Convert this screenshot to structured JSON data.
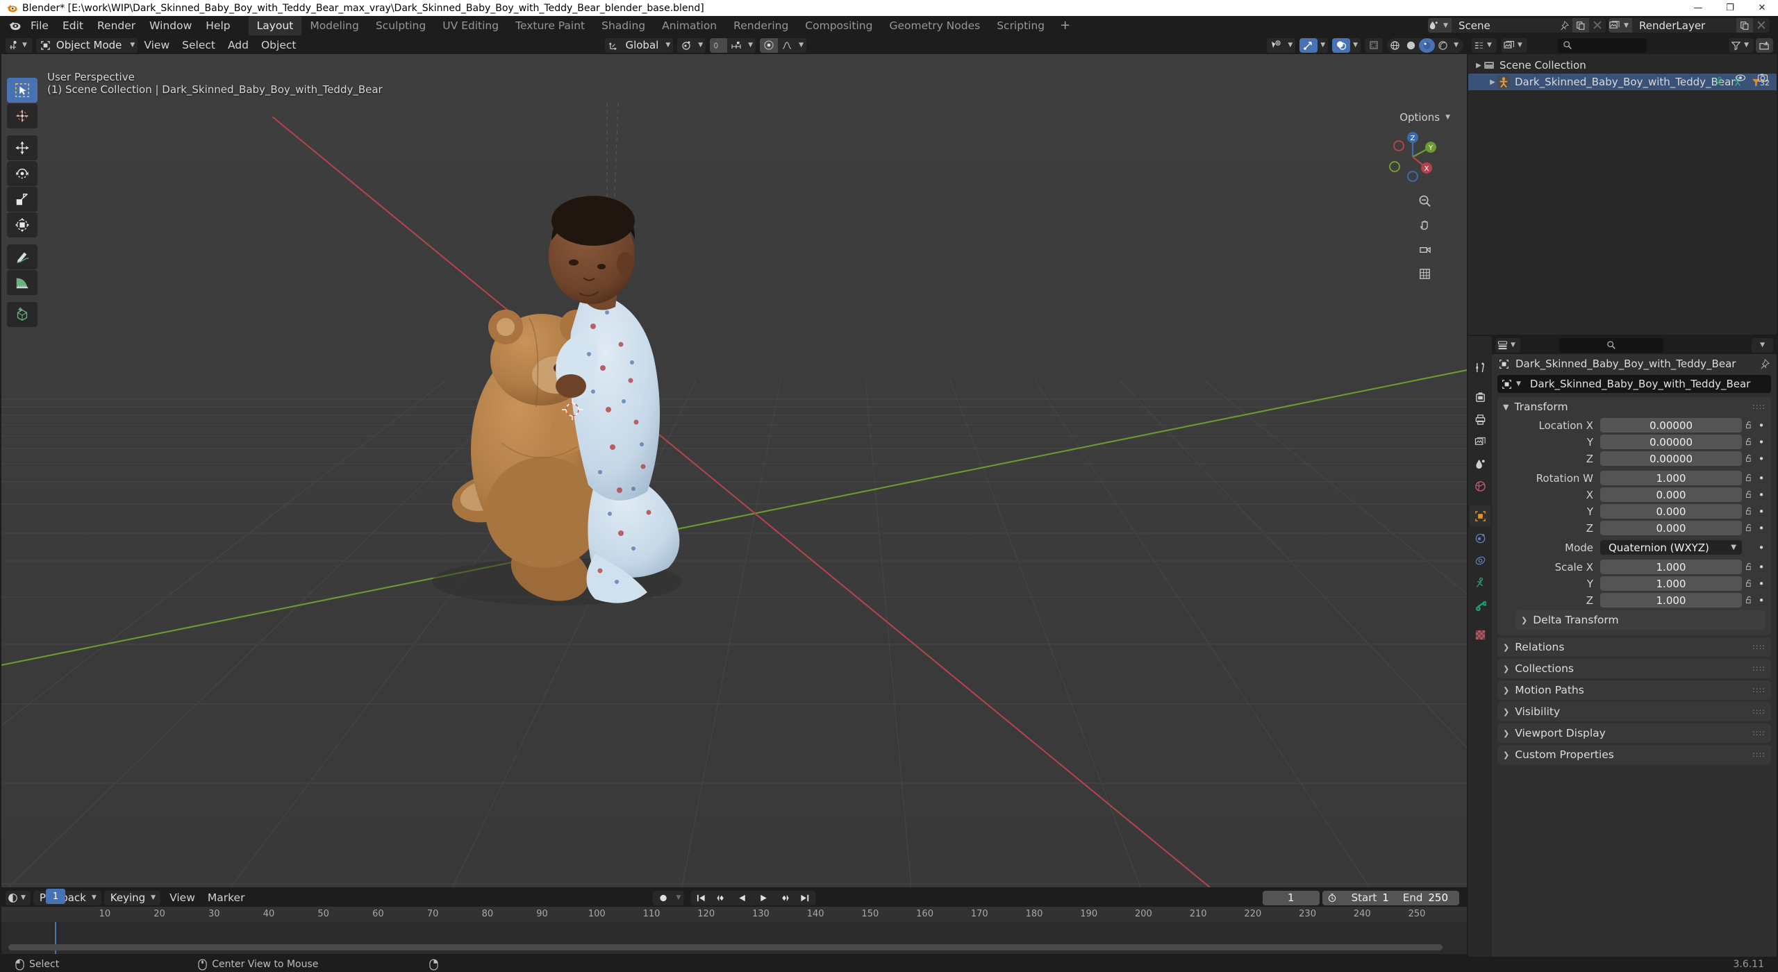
{
  "titlebar": {
    "text": "Blender* [E:\\work\\WIP\\Dark_Skinned_Baby_Boy_with_Teddy_Bear_max_vray\\Dark_Skinned_Baby_Boy_with_Teddy_Bear_blender_base.blend]",
    "minimize": "—",
    "maximize": "❐",
    "close": "✕"
  },
  "topbar": {
    "menus": [
      "File",
      "Edit",
      "Render",
      "Window",
      "Help"
    ],
    "workspaces": [
      {
        "label": "Layout",
        "active": true
      },
      {
        "label": "Modeling",
        "active": false
      },
      {
        "label": "Sculpting",
        "active": false
      },
      {
        "label": "UV Editing",
        "active": false
      },
      {
        "label": "Texture Paint",
        "active": false
      },
      {
        "label": "Shading",
        "active": false
      },
      {
        "label": "Animation",
        "active": false
      },
      {
        "label": "Rendering",
        "active": false
      },
      {
        "label": "Compositing",
        "active": false
      },
      {
        "label": "Geometry Nodes",
        "active": false
      },
      {
        "label": "Scripting",
        "active": false
      }
    ],
    "add_workspace": "+",
    "scene_name": "Scene",
    "viewlayer_name": "RenderLayer"
  },
  "viewport": {
    "mode": "Object Mode",
    "menus": [
      "View",
      "Select",
      "Add",
      "Object"
    ],
    "transform_orientation": "Global",
    "overlay_line1": "User Perspective",
    "overlay_line2": "(1) Scene Collection | Dark_Skinned_Baby_Boy_with_Teddy_Bear",
    "options_label": "Options",
    "gizmo_axes": {
      "z": "Z",
      "y": "Y",
      "x": "X"
    },
    "tools": [
      "tweak-select-box-tool",
      "cursor-tool",
      "move-tool",
      "rotate-tool",
      "scale-tool",
      "transform-tool",
      "annotate-tool",
      "measure-tool",
      "add-cube-tool"
    ]
  },
  "outliner": {
    "search_placeholder": "",
    "rows": [
      {
        "name": "Scene Collection",
        "indent": 0,
        "selected": false,
        "type": "collection"
      },
      {
        "name": "Dark_Skinned_Baby_Boy_with_Teddy_Bear",
        "indent": 1,
        "selected": true,
        "type": "armature",
        "modifier_count": "32"
      }
    ]
  },
  "properties": {
    "breadcrumb": "Dark_Skinned_Baby_Boy_with_Teddy_Bear",
    "object_name": "Dark_Skinned_Baby_Boy_with_Teddy_Bear",
    "transform": {
      "title": "Transform",
      "rows": [
        {
          "label": "Location X",
          "value": "0.00000"
        },
        {
          "label": "Y",
          "value": "0.00000"
        },
        {
          "label": "Z",
          "value": "0.00000"
        },
        {
          "label": "Rotation W",
          "value": "1.000"
        },
        {
          "label": "X",
          "value": "0.000"
        },
        {
          "label": "Y",
          "value": "0.000"
        },
        {
          "label": "Z",
          "value": "0.000"
        }
      ],
      "mode_label": "Mode",
      "mode_value": "Quaternion (WXYZ)",
      "scale_rows": [
        {
          "label": "Scale X",
          "value": "1.000"
        },
        {
          "label": "Y",
          "value": "1.000"
        },
        {
          "label": "Z",
          "value": "1.000"
        }
      ]
    },
    "subpanel": "Delta Transform",
    "panels": [
      "Relations",
      "Collections",
      "Motion Paths",
      "Visibility",
      "Viewport Display",
      "Custom Properties"
    ],
    "tabs": [
      "tool-tab",
      "render-tab",
      "output-tab",
      "view-layer-tab",
      "scene-tab",
      "world-tab",
      "object-tab",
      "modifiers-tab",
      "physics-tab",
      "object-constraints-tab",
      "object-data-tab",
      "material-tab"
    ]
  },
  "timeline": {
    "menus": [
      "View",
      "Marker"
    ],
    "popovers": [
      "Playback",
      "Keying"
    ],
    "current_frame": "1",
    "start_label": "Start",
    "start_value": "1",
    "end_label": "End",
    "end_value": "250",
    "ticks": [
      "10",
      "20",
      "30",
      "40",
      "50",
      "60",
      "70",
      "80",
      "90",
      "100",
      "110",
      "120",
      "130",
      "140",
      "150",
      "160",
      "170",
      "180",
      "190",
      "200",
      "210",
      "220",
      "230",
      "240",
      "250"
    ],
    "playhead_frame": "1"
  },
  "statusbar": {
    "items": [
      {
        "icon": "mouse-left-icon",
        "label": "Select"
      },
      {
        "icon": "mouse-middle-icon",
        "label": "Center View to Mouse"
      },
      {
        "icon": "mouse-right-icon",
        "label": ""
      }
    ],
    "version": "3.6.11"
  },
  "colors": {
    "accent": "#4772b3",
    "header": "#1d1d1d",
    "panel": "#303030",
    "viewport_bg": "#3b3b3b",
    "axis_x": "#c4404a",
    "axis_y": "#7caa38"
  }
}
